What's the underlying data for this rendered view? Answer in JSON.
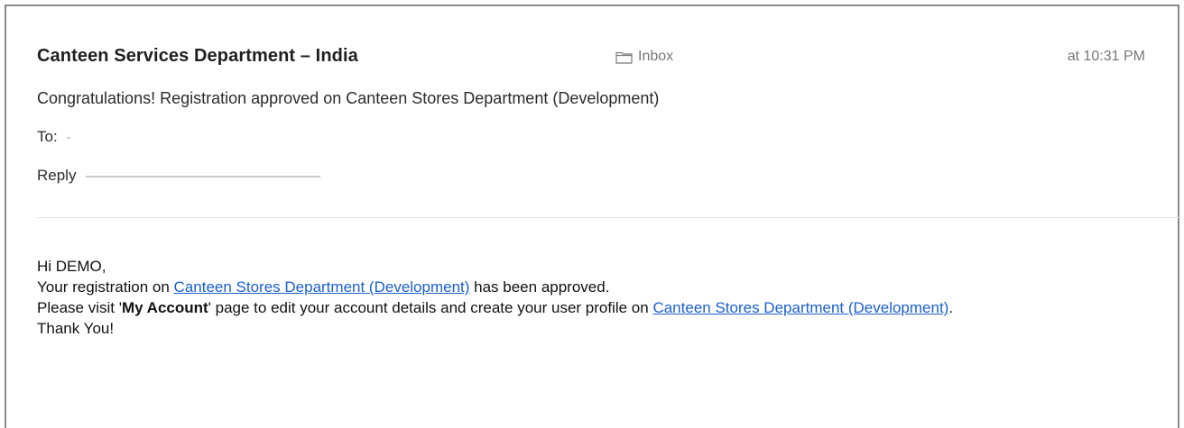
{
  "email": {
    "sender": "Canteen Services Department – India",
    "mailbox_icon": "folder-icon",
    "mailbox": "Inbox",
    "timestamp": "at 10:31 PM",
    "subject": "Congratulations! Registration approved on Canteen Stores Department (Development)",
    "to_label": "To:",
    "reply_label": "Reply"
  },
  "body": {
    "greeting": "Hi DEMO,",
    "line1_prefix": "Your registration on ",
    "line1_link": "Canteen Stores Department (Development)",
    "line1_suffix": " has been approved.",
    "line2_prefix": "Please visit '",
    "line2_bold": "My Account",
    "line2_middle": "' page to edit your account details and create your user profile on ",
    "line2_link": "Canteen Stores Department (Development)",
    "line2_suffix": ".",
    "signoff": "Thank You!"
  },
  "colors": {
    "link": "#1a5fd0",
    "meta_text": "#777777",
    "frame_border": "#8a8a8a"
  }
}
